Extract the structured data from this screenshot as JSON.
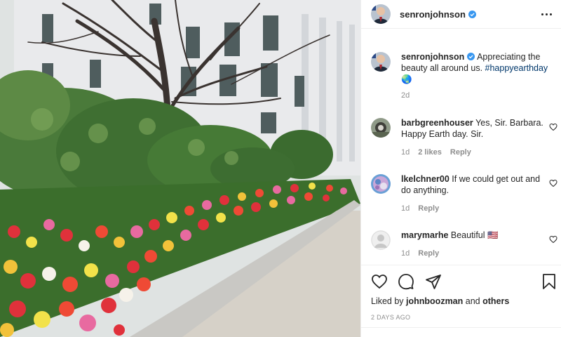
{
  "photo": {
    "description_icon": "post-photo"
  },
  "post": {
    "author": "senronjohnson",
    "verified": true,
    "caption_text": "Appreciating the beauty all around us. ",
    "caption_hashtag": "#happyearthday",
    "caption_emoji": "🌏",
    "caption_age": "2d",
    "likes_prefix": "Liked by ",
    "likes_user": "johnboozman",
    "likes_mid": " and ",
    "likes_others": "others",
    "date": "2 DAYS AGO"
  },
  "comments": [
    {
      "user": "barbgreenhouser",
      "text": "Yes, Sir. Barbara. Happy Earth day. Sir.",
      "age": "1d",
      "likes": "2 likes",
      "reply": "Reply"
    },
    {
      "user": "lkelchner00",
      "text": "If we could get out and do anything.",
      "age": "1d",
      "likes": "",
      "reply": "Reply"
    },
    {
      "user": "marymarhe",
      "text": "Beautiful 🇺🇸",
      "age": "1d",
      "likes": "",
      "reply": "Reply"
    }
  ],
  "icons": {
    "more": "more-options-icon",
    "like": "heart-icon",
    "comment": "comment-icon",
    "share": "share-icon",
    "save": "bookmark-icon",
    "verified": "verified-badge-icon"
  },
  "colors": {
    "verified": "#3897f0",
    "hashtag": "#00376b",
    "meta": "#8e8e8e",
    "divider": "#efefef"
  }
}
